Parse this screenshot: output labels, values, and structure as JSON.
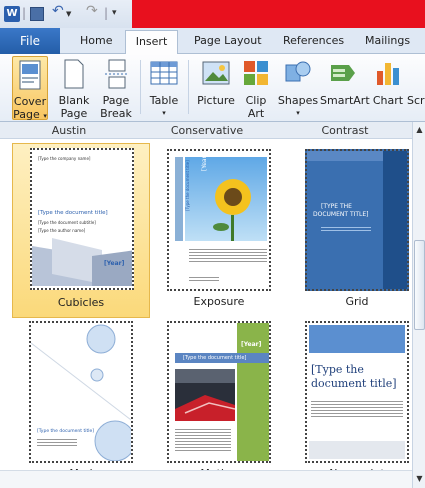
{
  "window": {
    "title_bar_color": "#e8101e"
  },
  "qat": {
    "icons": [
      "word-app-icon",
      "save-icon",
      "undo-icon",
      "redo-icon",
      "customize-qat-icon"
    ],
    "separators": [
      "|",
      "|"
    ]
  },
  "tabs": [
    {
      "label": "File",
      "active": false
    },
    {
      "label": "Home",
      "active": false
    },
    {
      "label": "Insert",
      "active": true
    },
    {
      "label": "Page Layout",
      "active": false
    },
    {
      "label": "References",
      "active": false
    },
    {
      "label": "Mailings",
      "active": false
    }
  ],
  "ribbon": {
    "cover_page": {
      "line1": "Cover",
      "line2": "Page"
    },
    "blank_page": {
      "line1": "Blank",
      "line2": "Page"
    },
    "page_break": {
      "line1": "Page",
      "line2": "Break"
    },
    "table": {
      "line1": "Table"
    },
    "picture": {
      "line1": "Picture"
    },
    "clip_art": {
      "line1": "Clip",
      "line2": "Art"
    },
    "shapes": {
      "line1": "Shapes"
    },
    "smartart": {
      "line1": "SmartArt"
    },
    "chart": {
      "line1": "Chart"
    },
    "screenshot": {
      "line1": "Scr"
    }
  },
  "gallery": {
    "headers": [
      "Austin",
      "Conservative",
      "Contrast"
    ],
    "items": [
      {
        "name": "Cubicles",
        "selected": true,
        "texts": {
          "company": "[Type the company name]",
          "title": "[Type the document title]",
          "subtitle": "[Type the document subtitle]",
          "author": "[Type the author name]",
          "year": "[Year]"
        }
      },
      {
        "name": "Exposure",
        "selected": false,
        "texts": {
          "year": "[Year]",
          "title": "[Type the document title]"
        }
      },
      {
        "name": "Grid",
        "selected": false,
        "texts": {
          "title_line1": "[TYPE THE",
          "title_line2": "DOCUMENT TITLE]"
        }
      },
      {
        "name": "Mod",
        "selected": false,
        "texts": {
          "title": "[Type the document title]"
        }
      },
      {
        "name": "Motion",
        "selected": false,
        "texts": {
          "year": "[Year]",
          "title": "[Type the document title]"
        }
      },
      {
        "name": "Newsprint",
        "selected": false,
        "texts": {
          "title_line1": "[Type the",
          "title_line2": "document title]"
        }
      }
    ]
  },
  "colors": {
    "accent": "#245ea8",
    "selection": "#fbd97a",
    "grid_blue": "#3a6fb0",
    "motion_green": "#8ab44a"
  }
}
